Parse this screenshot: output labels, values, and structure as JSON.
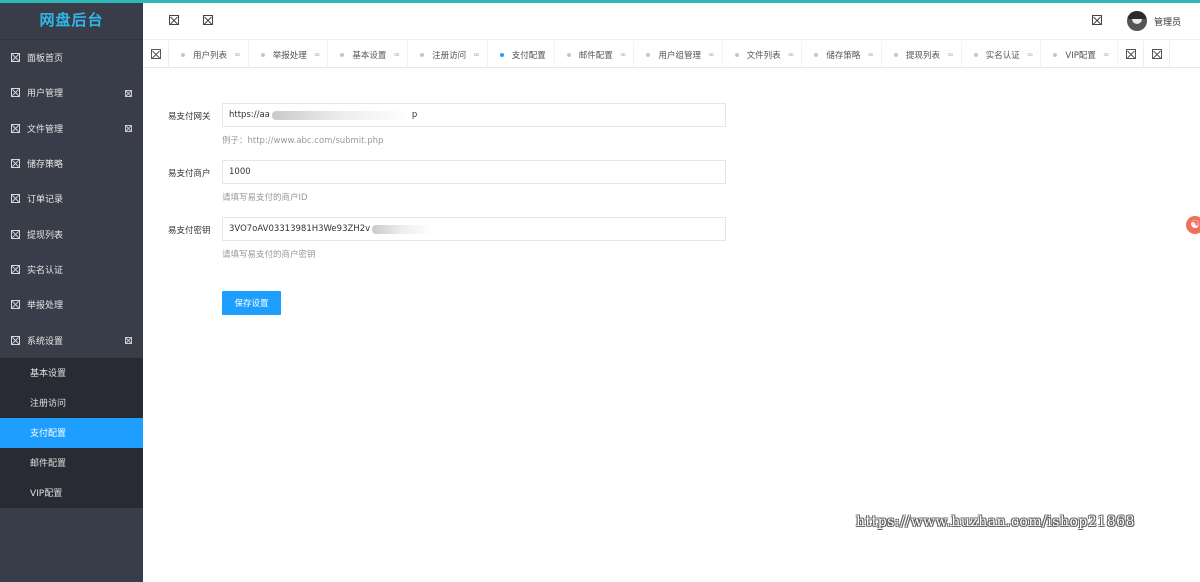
{
  "app": {
    "title": "网盘后台"
  },
  "sidebar": {
    "items": [
      {
        "label": "面板首页"
      },
      {
        "label": "用户管理"
      },
      {
        "label": "文件管理"
      },
      {
        "label": "储存策略"
      },
      {
        "label": "订单记录"
      },
      {
        "label": "提现列表"
      },
      {
        "label": "实名认证"
      },
      {
        "label": "举报处理"
      },
      {
        "label": "系统设置"
      }
    ],
    "subitems": [
      {
        "label": "基本设置"
      },
      {
        "label": "注册访问"
      },
      {
        "label": "支付配置"
      },
      {
        "label": "邮件配置"
      },
      {
        "label": "VIP配置"
      }
    ]
  },
  "header": {
    "username": "管理员"
  },
  "tabs": [
    {
      "label": "用户列表"
    },
    {
      "label": "举报处理"
    },
    {
      "label": "基本设置"
    },
    {
      "label": "注册访问"
    },
    {
      "label": "支付配置"
    },
    {
      "label": "邮件配置"
    },
    {
      "label": "用户组管理"
    },
    {
      "label": "文件列表"
    },
    {
      "label": "储存策略"
    },
    {
      "label": "提现列表"
    },
    {
      "label": "实名认证"
    },
    {
      "label": "VIP配置"
    }
  ],
  "tab_close_glyph": "∞",
  "form": {
    "gateway": {
      "label": "易支付网关",
      "value": "https://aa",
      "value_tail": "p",
      "hint": "例子：http://www.abc.com/submit.php"
    },
    "merchant": {
      "label": "易支付商户",
      "value": "1000",
      "hint": "请填写易支付的商户ID"
    },
    "secret": {
      "label": "易支付密钥",
      "value": "3VO7oAV03313981H3We93ZH2v",
      "hint": "请填写易支付的商户密钥"
    },
    "save_label": "保存设置"
  },
  "float_icon": "☯",
  "watermark": "https://www.huzhan.com/ishop21868",
  "colors": {
    "sidebar": "#393d49",
    "accent": "#1e9fff",
    "logo": "#2fb8e8"
  }
}
